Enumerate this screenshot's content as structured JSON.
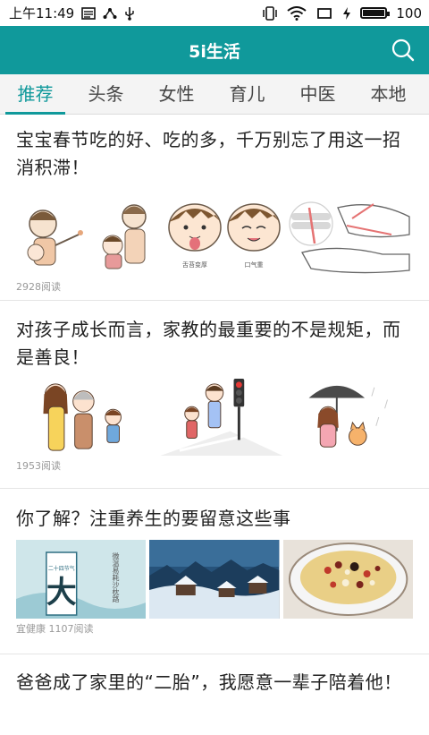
{
  "status_bar": {
    "time": "上午11:49",
    "battery": "100",
    "battery_level": 1.0
  },
  "app_bar": {
    "title": "5i生活",
    "search_icon": "search-icon",
    "color": "#10999b"
  },
  "tabs": [
    {
      "label": "推荐",
      "active": true
    },
    {
      "label": "头条",
      "active": false
    },
    {
      "label": "女性",
      "active": false
    },
    {
      "label": "育儿",
      "active": false
    },
    {
      "label": "中医",
      "active": false
    },
    {
      "label": "本地",
      "active": false
    }
  ],
  "articles": [
    {
      "title": "宝宝春节吃的好、吃的多，千万别忘了用这一招消积滞！",
      "image_labels": [
        "舌苔变厚",
        "口气重"
      ],
      "meta": "2928阅读"
    },
    {
      "title": "对孩子成长而言，家教的最重要的不是规矩，而是善良！",
      "meta": "1953阅读"
    },
    {
      "title": "你了解？注重养生的要留意这些事",
      "image_texts": {
        "calendar": "二十四节气",
        "big_char": "大",
        "vertical": "微温易耗沙枕路"
      },
      "meta": "宜健康 1107阅读"
    },
    {
      "title": "爸爸成了家里的“二胎”，我愿意一辈子陪着他！"
    }
  ]
}
